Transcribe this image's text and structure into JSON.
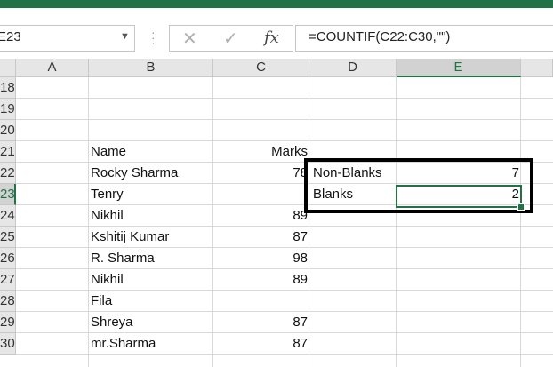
{
  "name_box": {
    "value": "E23"
  },
  "formula_bar": {
    "cancel_icon": "close-icon",
    "enter_icon": "check-icon",
    "fx_label": "fx",
    "formula": "=COUNTIF(C22:C30,\"\")"
  },
  "columns": [
    "A",
    "B",
    "C",
    "D",
    "E"
  ],
  "selected_column": "E",
  "rows": [
    {
      "num": "18",
      "b": "",
      "c": "",
      "d": "",
      "e": ""
    },
    {
      "num": "19",
      "b": "",
      "c": "",
      "d": "",
      "e": ""
    },
    {
      "num": "20",
      "b": "",
      "c": "",
      "d": "",
      "e": ""
    },
    {
      "num": "21",
      "b": "Name",
      "c": "Marks",
      "d": "",
      "e": ""
    },
    {
      "num": "22",
      "b": "Rocky Sharma",
      "c": "78",
      "d": "Non-Blanks",
      "e": "7"
    },
    {
      "num": "23",
      "b": "Tenry",
      "c": "",
      "d": "Blanks",
      "e": "2"
    },
    {
      "num": "24",
      "b": "Nikhil",
      "c": "89",
      "d": "",
      "e": ""
    },
    {
      "num": "25",
      "b": "Kshitij Kumar",
      "c": "87",
      "d": "",
      "e": ""
    },
    {
      "num": "26",
      "b": "R. Sharma",
      "c": "98",
      "d": "",
      "e": ""
    },
    {
      "num": "27",
      "b": "Nikhil",
      "c": "89",
      "d": "",
      "e": ""
    },
    {
      "num": "28",
      "b": "Fila",
      "c": "",
      "d": "",
      "e": ""
    },
    {
      "num": "29",
      "b": "Shreya",
      "c": "87",
      "d": "",
      "e": ""
    },
    {
      "num": "30",
      "b": "mr.Sharma",
      "c": "87",
      "d": "",
      "e": ""
    }
  ],
  "selected_row": "23",
  "colors": {
    "excel_green": "#217346",
    "header_bg": "#e6e6e6",
    "highlight_box": "#000000"
  }
}
